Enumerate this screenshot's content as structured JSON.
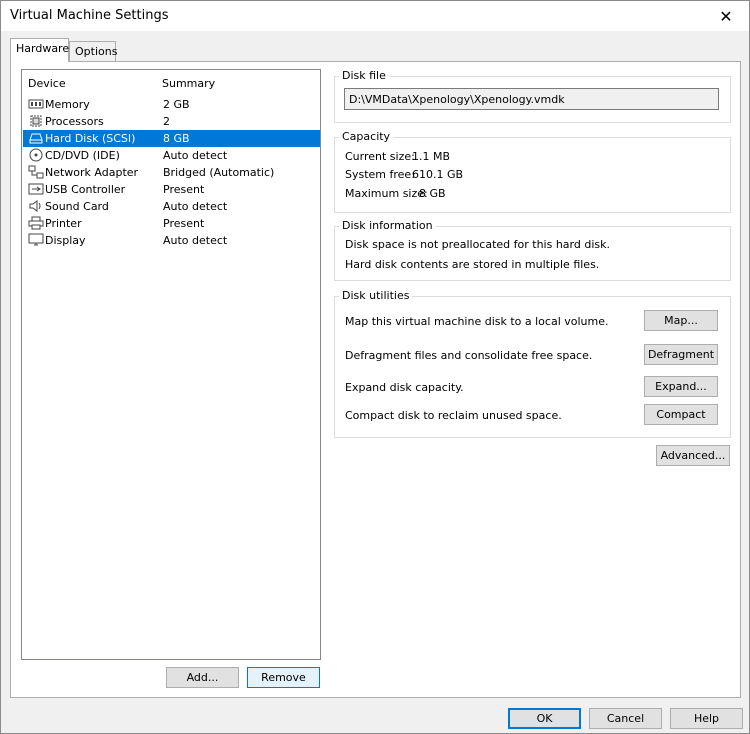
{
  "window": {
    "title": "Virtual Machine Settings",
    "close_glyph": "✕"
  },
  "tabs": [
    {
      "label": "Hardware"
    },
    {
      "label": "Options"
    }
  ],
  "device_list": {
    "header_device": "Device",
    "header_summary": "Summary",
    "items": [
      {
        "name": "Memory",
        "summary": "2 GB",
        "icon": "memory-icon"
      },
      {
        "name": "Processors",
        "summary": "2",
        "icon": "processor-icon"
      },
      {
        "name": "Hard Disk (SCSI)",
        "summary": "8 GB",
        "icon": "hard-disk-icon",
        "selected": true
      },
      {
        "name": "CD/DVD (IDE)",
        "summary": "Auto detect",
        "icon": "cd-dvd-icon"
      },
      {
        "name": "Network Adapter",
        "summary": "Bridged (Automatic)",
        "icon": "network-adapter-icon"
      },
      {
        "name": "USB Controller",
        "summary": "Present",
        "icon": "usb-icon"
      },
      {
        "name": "Sound Card",
        "summary": "Auto detect",
        "icon": "speaker-icon"
      },
      {
        "name": "Printer",
        "summary": "Present",
        "icon": "printer-icon"
      },
      {
        "name": "Display",
        "summary": "Auto detect",
        "icon": "monitor-icon"
      }
    ],
    "add_label": "Add...",
    "remove_label": "Remove"
  },
  "disk_file": {
    "label": "Disk file",
    "path": "D:\\VMData\\Xpenology\\Xpenology.vmdk"
  },
  "capacity": {
    "label": "Capacity",
    "current_size_label": "Current size:",
    "current_size_value": "1.1 MB",
    "system_free_label": "System free:",
    "system_free_value": "610.1 GB",
    "maximum_size_label": "Maximum size:",
    "maximum_size_value": "8 GB"
  },
  "disk_information": {
    "label": "Disk information",
    "line1": "Disk space is not preallocated for this hard disk.",
    "line2": "Hard disk contents are stored in multiple files."
  },
  "disk_utilities": {
    "label": "Disk utilities",
    "map_text": "Map this virtual machine disk to a local volume.",
    "map_button": "Map...",
    "defrag_text": "Defragment files and consolidate free space.",
    "defrag_button": "Defragment",
    "expand_text": "Expand disk capacity.",
    "expand_button": "Expand...",
    "compact_text": "Compact disk to reclaim unused space.",
    "compact_button": "Compact"
  },
  "advanced_label": "Advanced...",
  "footer": {
    "ok_label": "OK",
    "cancel_label": "Cancel",
    "help_label": "Help"
  },
  "colors": {
    "selection": "#0078d7",
    "window_bg": "#f0f0f0",
    "panel_bg": "#ffffff"
  }
}
